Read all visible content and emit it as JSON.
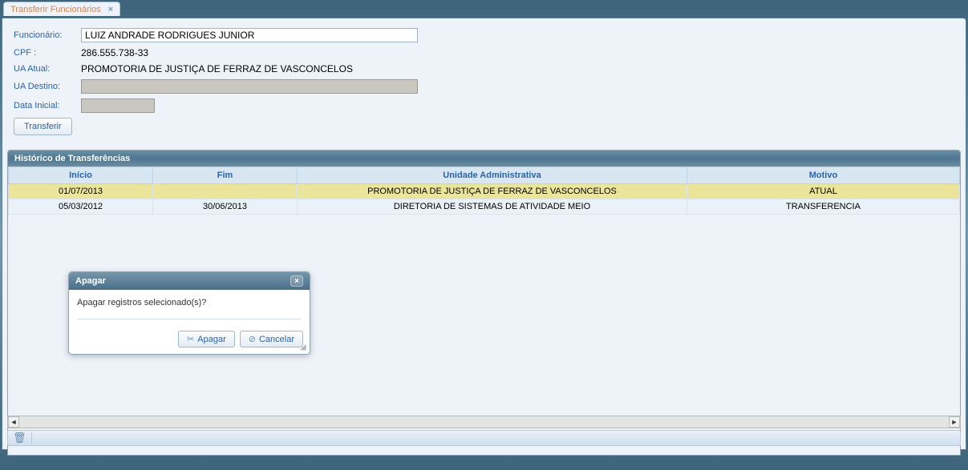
{
  "tab": {
    "title": "Transferir Funcionários"
  },
  "form": {
    "labels": {
      "funcionario": "Funcionário:",
      "cpf": "CPF :",
      "ua_atual": "UA Atual:",
      "ua_destino": "UA Destino:",
      "data_inicial": "Data Inicial:"
    },
    "values": {
      "funcionario": "LUIZ ANDRADE RODRIGUES JUNIOR",
      "cpf": "286.555.738-33",
      "ua_atual": "PROMOTORIA DE JUSTIÇA DE FERRAZ DE VASCONCELOS",
      "ua_destino": "",
      "data_inicial": ""
    },
    "transferir_btn": "Transferir"
  },
  "history": {
    "title": "Histórico de Transferências",
    "columns": {
      "inicio": "Início",
      "fim": "Fim",
      "unidade": "Unidade Administrativa",
      "motivo": "Motivo"
    },
    "rows": [
      {
        "inicio": "01/07/2013",
        "fim": "",
        "unidade": "PROMOTORIA DE JUSTIÇA DE FERRAZ DE VASCONCELOS",
        "motivo": "ATUAL"
      },
      {
        "inicio": "05/03/2012",
        "fim": "30/06/2013",
        "unidade": "DIRETORIA DE SISTEMAS DE ATIVIDADE MEIO",
        "motivo": "TRANSFERENCIA"
      }
    ]
  },
  "dialog": {
    "title": "Apagar",
    "message": "Apagar registros selecionado(s)?",
    "apagar_btn": "Apagar",
    "cancelar_btn": "Cancelar"
  }
}
